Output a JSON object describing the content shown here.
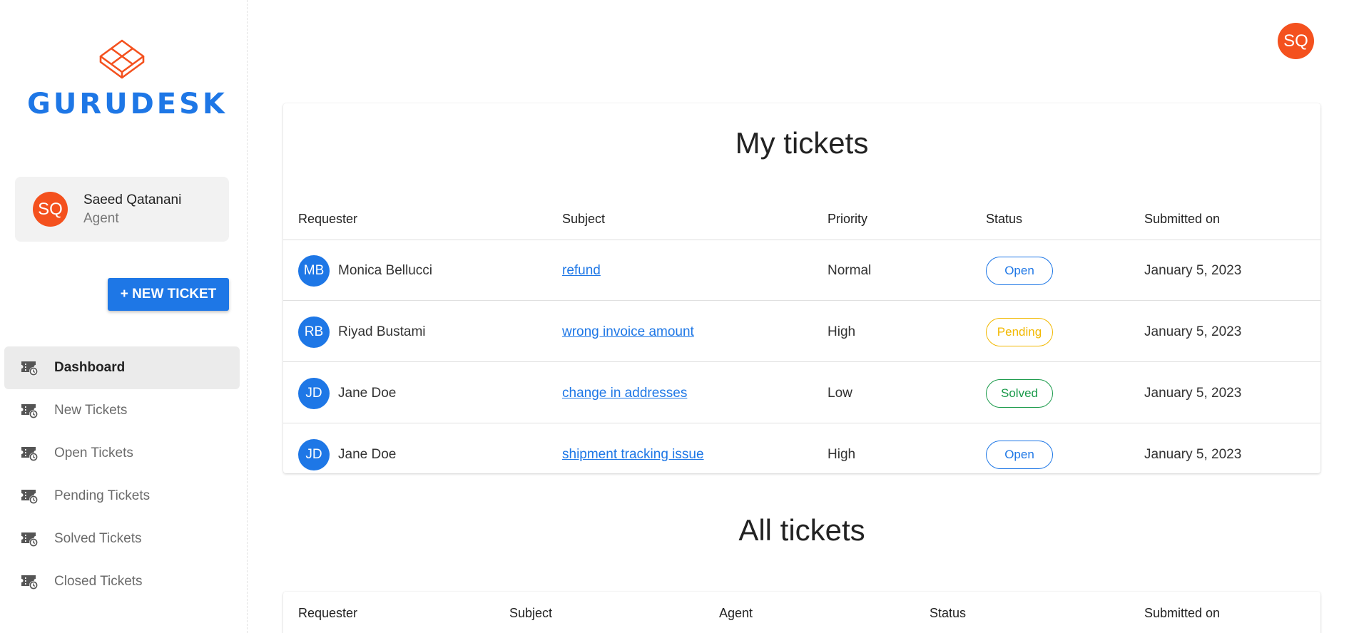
{
  "brand": {
    "name": "GURUDESK",
    "logo_icon": "cube-outline-icon",
    "primary_color": "#1e77e6",
    "accent_color": "#f4511e"
  },
  "user": {
    "initials": "SQ",
    "name": "Saeed Qatanani",
    "role": "Agent"
  },
  "sidebar": {
    "new_ticket_label": "+ NEW TICKET",
    "items": [
      {
        "label": "Dashboard",
        "icon": "ticket-icon",
        "active": true
      },
      {
        "label": "New Tickets",
        "icon": "ticket-icon",
        "active": false
      },
      {
        "label": "Open Tickets",
        "icon": "ticket-icon",
        "active": false
      },
      {
        "label": "Pending Tickets",
        "icon": "ticket-icon",
        "active": false
      },
      {
        "label": "Solved Tickets",
        "icon": "ticket-icon",
        "active": false
      },
      {
        "label": "Closed Tickets",
        "icon": "ticket-icon",
        "active": false
      }
    ]
  },
  "header": {
    "avatar_initials": "SQ"
  },
  "my_tickets": {
    "title": "My tickets",
    "columns": [
      "Requester",
      "Subject",
      "Priority",
      "Status",
      "Submitted on"
    ],
    "rows": [
      {
        "initials": "MB",
        "requester": "Monica Bellucci",
        "subject": "refund",
        "priority": "Normal",
        "status": "Open",
        "submitted": "January 5, 2023"
      },
      {
        "initials": "RB",
        "requester": "Riyad Bustami",
        "subject": "wrong invoice amount",
        "priority": "High",
        "status": "Pending",
        "submitted": "January 5, 2023"
      },
      {
        "initials": "JD",
        "requester": "Jane Doe",
        "subject": "change in addresses",
        "priority": "Low",
        "status": "Solved",
        "submitted": "January 5, 2023"
      },
      {
        "initials": "JD",
        "requester": "Jane Doe",
        "subject": "shipment tracking issue",
        "priority": "High",
        "status": "Open",
        "submitted": "January 5, 2023"
      }
    ]
  },
  "status_colors": {
    "Open": "#1e77e6",
    "Pending": "#f2b800",
    "Solved": "#1a9a4a"
  },
  "all_tickets": {
    "title": "All tickets",
    "columns": [
      "Requester",
      "Subject",
      "Agent",
      "Status",
      "Submitted on"
    ]
  }
}
